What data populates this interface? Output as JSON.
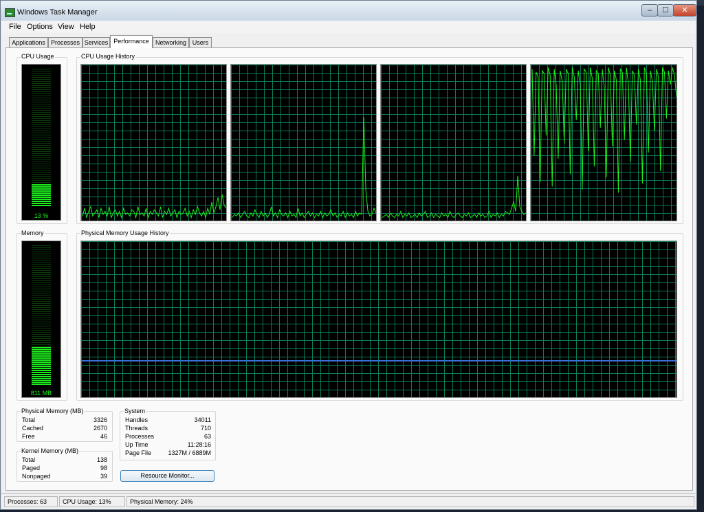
{
  "window": {
    "title": "Windows Task Manager",
    "controls": {
      "minimize": "–",
      "maximize": "☐",
      "close": "✕"
    }
  },
  "menu": [
    "File",
    "Options",
    "View",
    "Help"
  ],
  "tabs": [
    "Applications",
    "Processes",
    "Services",
    "Performance",
    "Networking",
    "Users"
  ],
  "active_tab": "Performance",
  "cpu_usage": {
    "label": "CPU Usage",
    "value_text": "13 %",
    "percent": 13
  },
  "cpu_history": {
    "label": "CPU Usage History",
    "cores": [
      {
        "values": [
          3,
          8,
          2,
          6,
          9,
          3,
          5,
          7,
          2,
          8,
          4,
          6,
          3,
          9,
          2,
          5,
          7,
          3,
          6,
          2,
          8,
          4,
          5,
          3,
          7,
          6,
          2,
          9,
          4,
          5,
          3,
          8,
          2,
          6,
          4,
          7,
          5,
          3,
          9,
          2,
          6,
          4,
          8,
          3,
          5,
          7,
          2,
          6,
          4,
          5,
          8,
          3,
          6,
          2,
          7,
          4,
          9,
          5,
          3,
          6,
          2,
          8,
          4,
          12,
          5,
          9,
          15,
          7,
          17,
          10,
          8
        ]
      },
      {
        "values": [
          2,
          4,
          3,
          5,
          2,
          4,
          6,
          3,
          2,
          5,
          3,
          7,
          4,
          2,
          6,
          3,
          5,
          2,
          4,
          9,
          3,
          5,
          2,
          7,
          4,
          3,
          5,
          2,
          6,
          3,
          4,
          2,
          8,
          3,
          5,
          2,
          4,
          6,
          3,
          5,
          2,
          4,
          3,
          6,
          2,
          5,
          3,
          4,
          7,
          3,
          5,
          2,
          4,
          3,
          6,
          2,
          5,
          3,
          4,
          2,
          6,
          3,
          5,
          4,
          67,
          20,
          6,
          3,
          4,
          8,
          5
        ]
      },
      {
        "values": [
          2,
          3,
          4,
          2,
          5,
          3,
          2,
          4,
          3,
          6,
          2,
          4,
          3,
          5,
          2,
          3,
          4,
          2,
          5,
          3,
          4,
          6,
          2,
          3,
          5,
          2,
          4,
          3,
          2,
          5,
          3,
          4,
          2,
          6,
          3,
          2,
          4,
          5,
          3,
          2,
          4,
          3,
          5,
          2,
          3,
          4,
          2,
          5,
          3,
          4,
          2,
          3,
          6,
          2,
          4,
          3,
          5,
          2,
          4,
          3,
          6,
          5,
          4,
          8,
          12,
          6,
          29,
          9,
          6,
          4,
          5
        ]
      },
      {
        "values": [
          98,
          42,
          96,
          93,
          25,
          97,
          95,
          55,
          99,
          94,
          22,
          98,
          88,
          40,
          97,
          90,
          50,
          98,
          95,
          30,
          99,
          93,
          65,
          97,
          88,
          20,
          98,
          96,
          45,
          99,
          92,
          35,
          97,
          95,
          60,
          98,
          86,
          28,
          99,
          94,
          48,
          97,
          91,
          18,
          98,
          96,
          52,
          99,
          89,
          38,
          97,
          94,
          62,
          98,
          91,
          24,
          99,
          95,
          44,
          97,
          90,
          58,
          98,
          93,
          32,
          99,
          96,
          66,
          97,
          88,
          99,
          94,
          80
        ]
      }
    ]
  },
  "memory": {
    "label": "Memory",
    "value_text": "811 MB",
    "percent": 24
  },
  "memory_history": {
    "label": "Physical Memory Usage History",
    "percent": 24
  },
  "physical_memory": {
    "label": "Physical Memory (MB)",
    "rows": [
      {
        "k": "Total",
        "v": "3326"
      },
      {
        "k": "Cached",
        "v": "2670"
      },
      {
        "k": "Free",
        "v": "46"
      }
    ]
  },
  "kernel_memory": {
    "label": "Kernel Memory (MB)",
    "rows": [
      {
        "k": "Total",
        "v": "138"
      },
      {
        "k": "Paged",
        "v": "98"
      },
      {
        "k": "Nonpaged",
        "v": "39"
      }
    ]
  },
  "system": {
    "label": "System",
    "rows": [
      {
        "k": "Handles",
        "v": "34011"
      },
      {
        "k": "Threads",
        "v": "710"
      },
      {
        "k": "Processes",
        "v": "63"
      },
      {
        "k": "Up Time",
        "v": "11:28:16"
      },
      {
        "k": "Page File",
        "v": "1327M / 6889M"
      }
    ]
  },
  "resource_monitor_button": "Resource Monitor...",
  "status": {
    "processes": "Processes: 63",
    "cpu": "CPU Usage: 13%",
    "memory": "Physical Memory: 24%"
  },
  "colors": {
    "graph_green": "#1cf01c",
    "grid": "#0a7d5a",
    "memory_line": "#3b6fd8"
  }
}
